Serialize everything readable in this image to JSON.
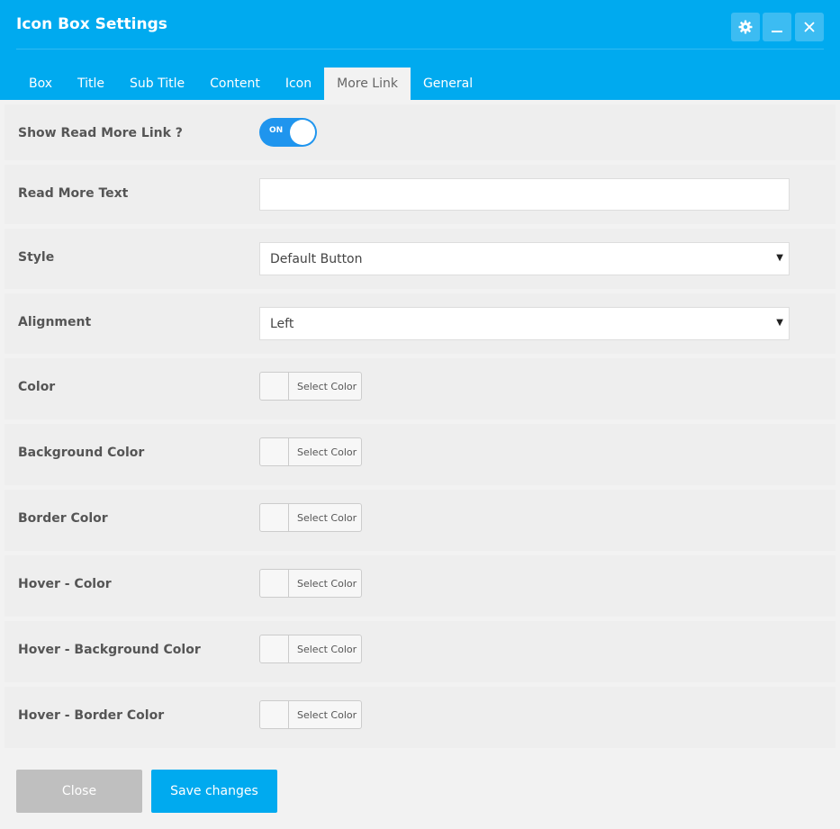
{
  "window": {
    "title": "Icon Box Settings",
    "icons": {
      "settings": "gear-icon",
      "minimize": "minimize-icon",
      "close": "close-icon"
    }
  },
  "tabs": [
    {
      "label": "Box"
    },
    {
      "label": "Title"
    },
    {
      "label": "Sub Title"
    },
    {
      "label": "Content"
    },
    {
      "label": "Icon"
    },
    {
      "label": "More Link",
      "active": true
    },
    {
      "label": "General"
    }
  ],
  "fields": {
    "show_read_more": {
      "label": "Show Read More Link ?",
      "state_text": "ON",
      "enabled": true
    },
    "read_more_text": {
      "label": "Read More Text",
      "value": "",
      "placeholder": ""
    },
    "style": {
      "label": "Style",
      "selected": "Default Button"
    },
    "alignment": {
      "label": "Alignment",
      "selected": "Left"
    },
    "color": {
      "label": "Color",
      "button": "Select Color"
    },
    "background_color": {
      "label": "Background Color",
      "button": "Select Color"
    },
    "border_color": {
      "label": "Border Color",
      "button": "Select Color"
    },
    "hover_color": {
      "label": "Hover - Color",
      "button": "Select Color"
    },
    "hover_background_color": {
      "label": "Hover - Background Color",
      "button": "Select Color"
    },
    "hover_border_color": {
      "label": "Hover - Border Color",
      "button": "Select Color"
    }
  },
  "footer": {
    "close_label": "Close",
    "save_label": "Save changes"
  },
  "colors": {
    "accent": "#00aaef",
    "toggle_on": "#1f95ee",
    "close_button": "#bfbfbf"
  }
}
